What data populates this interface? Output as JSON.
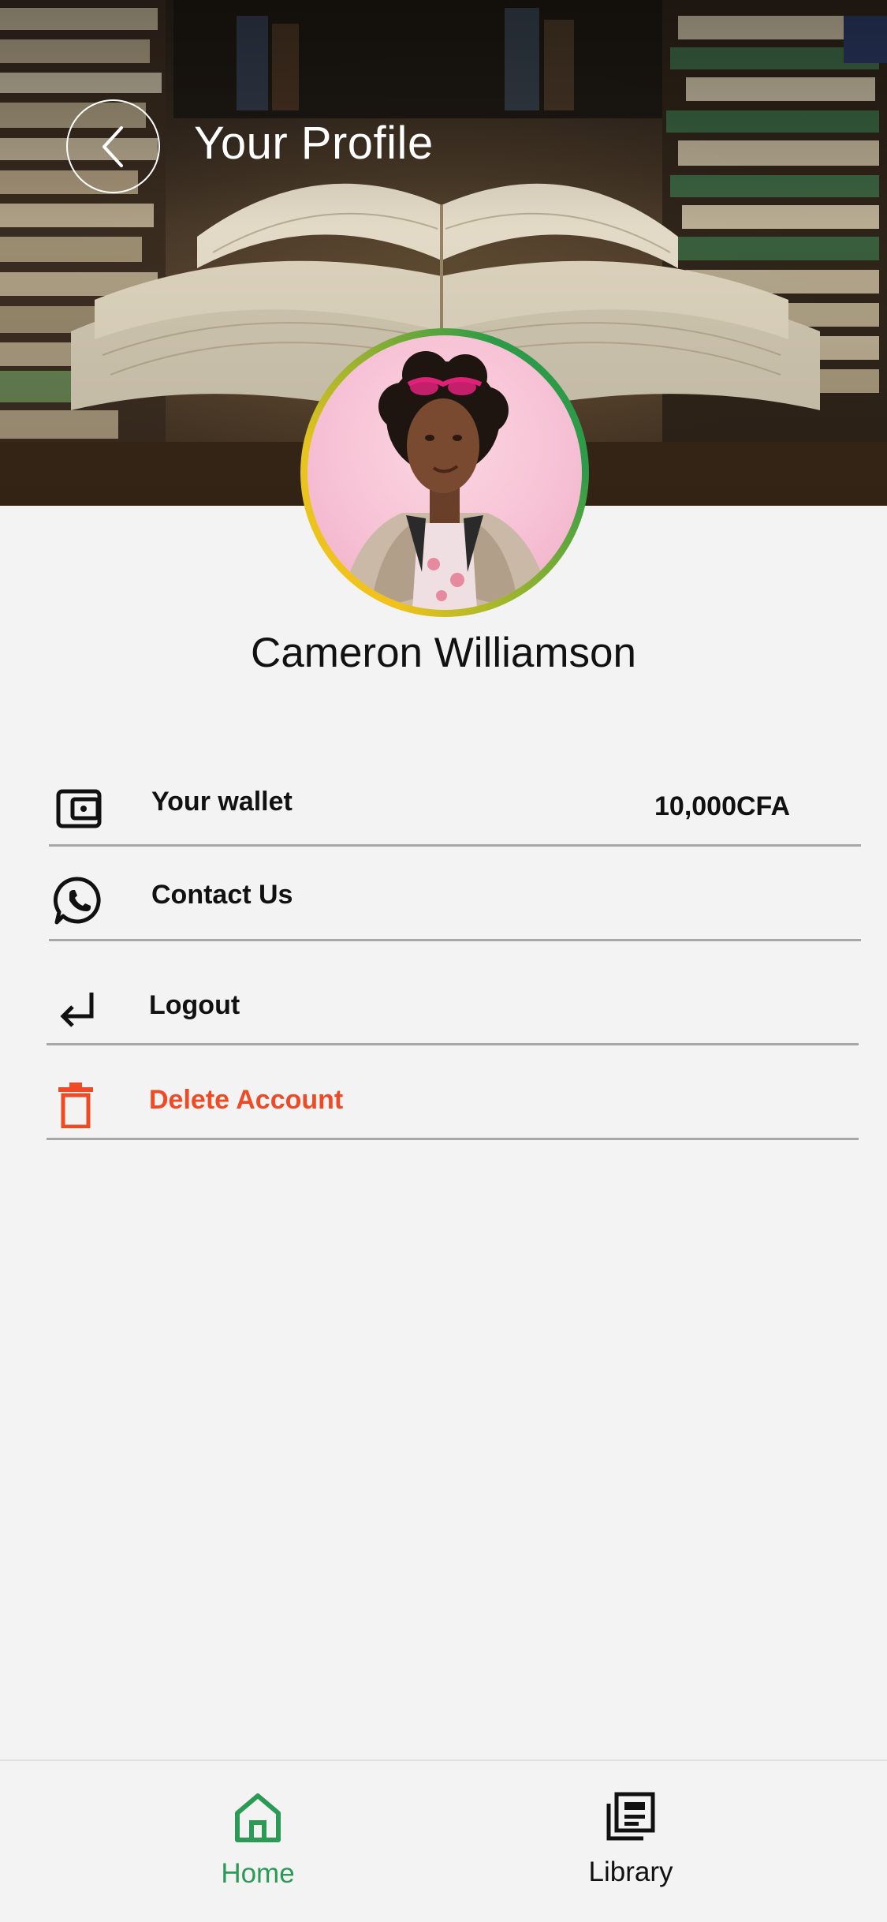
{
  "header": {
    "title": "Your Profile",
    "back_icon": "chevron-left-icon"
  },
  "profile": {
    "name": "Cameron Williamson",
    "ring_colors": [
      "#2e9b4a",
      "#f2c21b"
    ]
  },
  "menu": {
    "wallet": {
      "label": "Your wallet",
      "value": "10,000CFA",
      "icon": "wallet-icon"
    },
    "contact": {
      "label": "Contact Us",
      "icon": "whatsapp-icon"
    },
    "logout": {
      "label": "Logout",
      "icon": "logout-arrow-icon"
    },
    "delete": {
      "label": "Delete Account",
      "icon": "trash-icon",
      "color": "#ee4a25"
    }
  },
  "bottom_nav": {
    "items": [
      {
        "label": "Home",
        "icon": "home-icon",
        "active": true,
        "color": "#2a9a55"
      },
      {
        "label": "Library",
        "icon": "library-icon",
        "active": false,
        "color": "#111111"
      }
    ]
  }
}
